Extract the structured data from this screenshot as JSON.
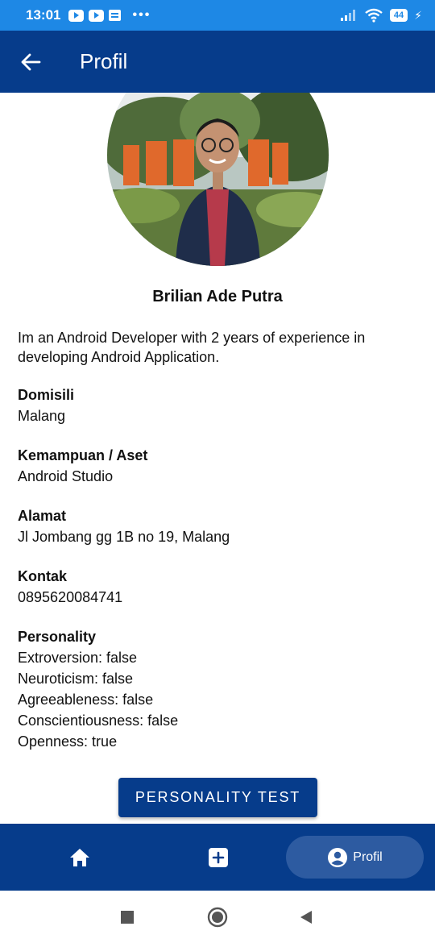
{
  "status_bar": {
    "time": "13:01",
    "battery": "44",
    "icons": [
      "youtube-icon",
      "youtube-icon",
      "message-icon",
      "more-dots-icon",
      "signal-icon",
      "wifi-icon",
      "battery-icon",
      "charging-icon"
    ]
  },
  "app_bar": {
    "title": "Profil",
    "back_icon": "arrow-left-icon"
  },
  "profile": {
    "name": "Brilian Ade Putra",
    "bio": "Im an Android Developer with 2 years of experience in developing Android Application.",
    "fields": [
      {
        "label": "Domisili",
        "value": "Malang"
      },
      {
        "label": "Kemampuan / Aset",
        "value": "Android Studio"
      },
      {
        "label": "Alamat",
        "value": "Jl Jombang gg 1B no 19, Malang"
      },
      {
        "label": "Kontak",
        "value": "0895620084741"
      }
    ],
    "personality": {
      "label": "Personality",
      "lines": [
        "Extroversion: false",
        "Neuroticism: false",
        "Agreeableness: false",
        "Conscientiousness: false",
        "Openness: true"
      ]
    },
    "personality_button": "PERSONALITY TEST"
  },
  "bottom_nav": {
    "items": [
      {
        "icon": "home-icon"
      },
      {
        "icon": "add-box-icon"
      },
      {
        "icon": "account-circle-icon",
        "label": "Profil",
        "active": true
      }
    ]
  },
  "colors": {
    "primary": "#063c8b",
    "status_bar": "#1e88e5",
    "nav_active": "#2d5ba1"
  }
}
